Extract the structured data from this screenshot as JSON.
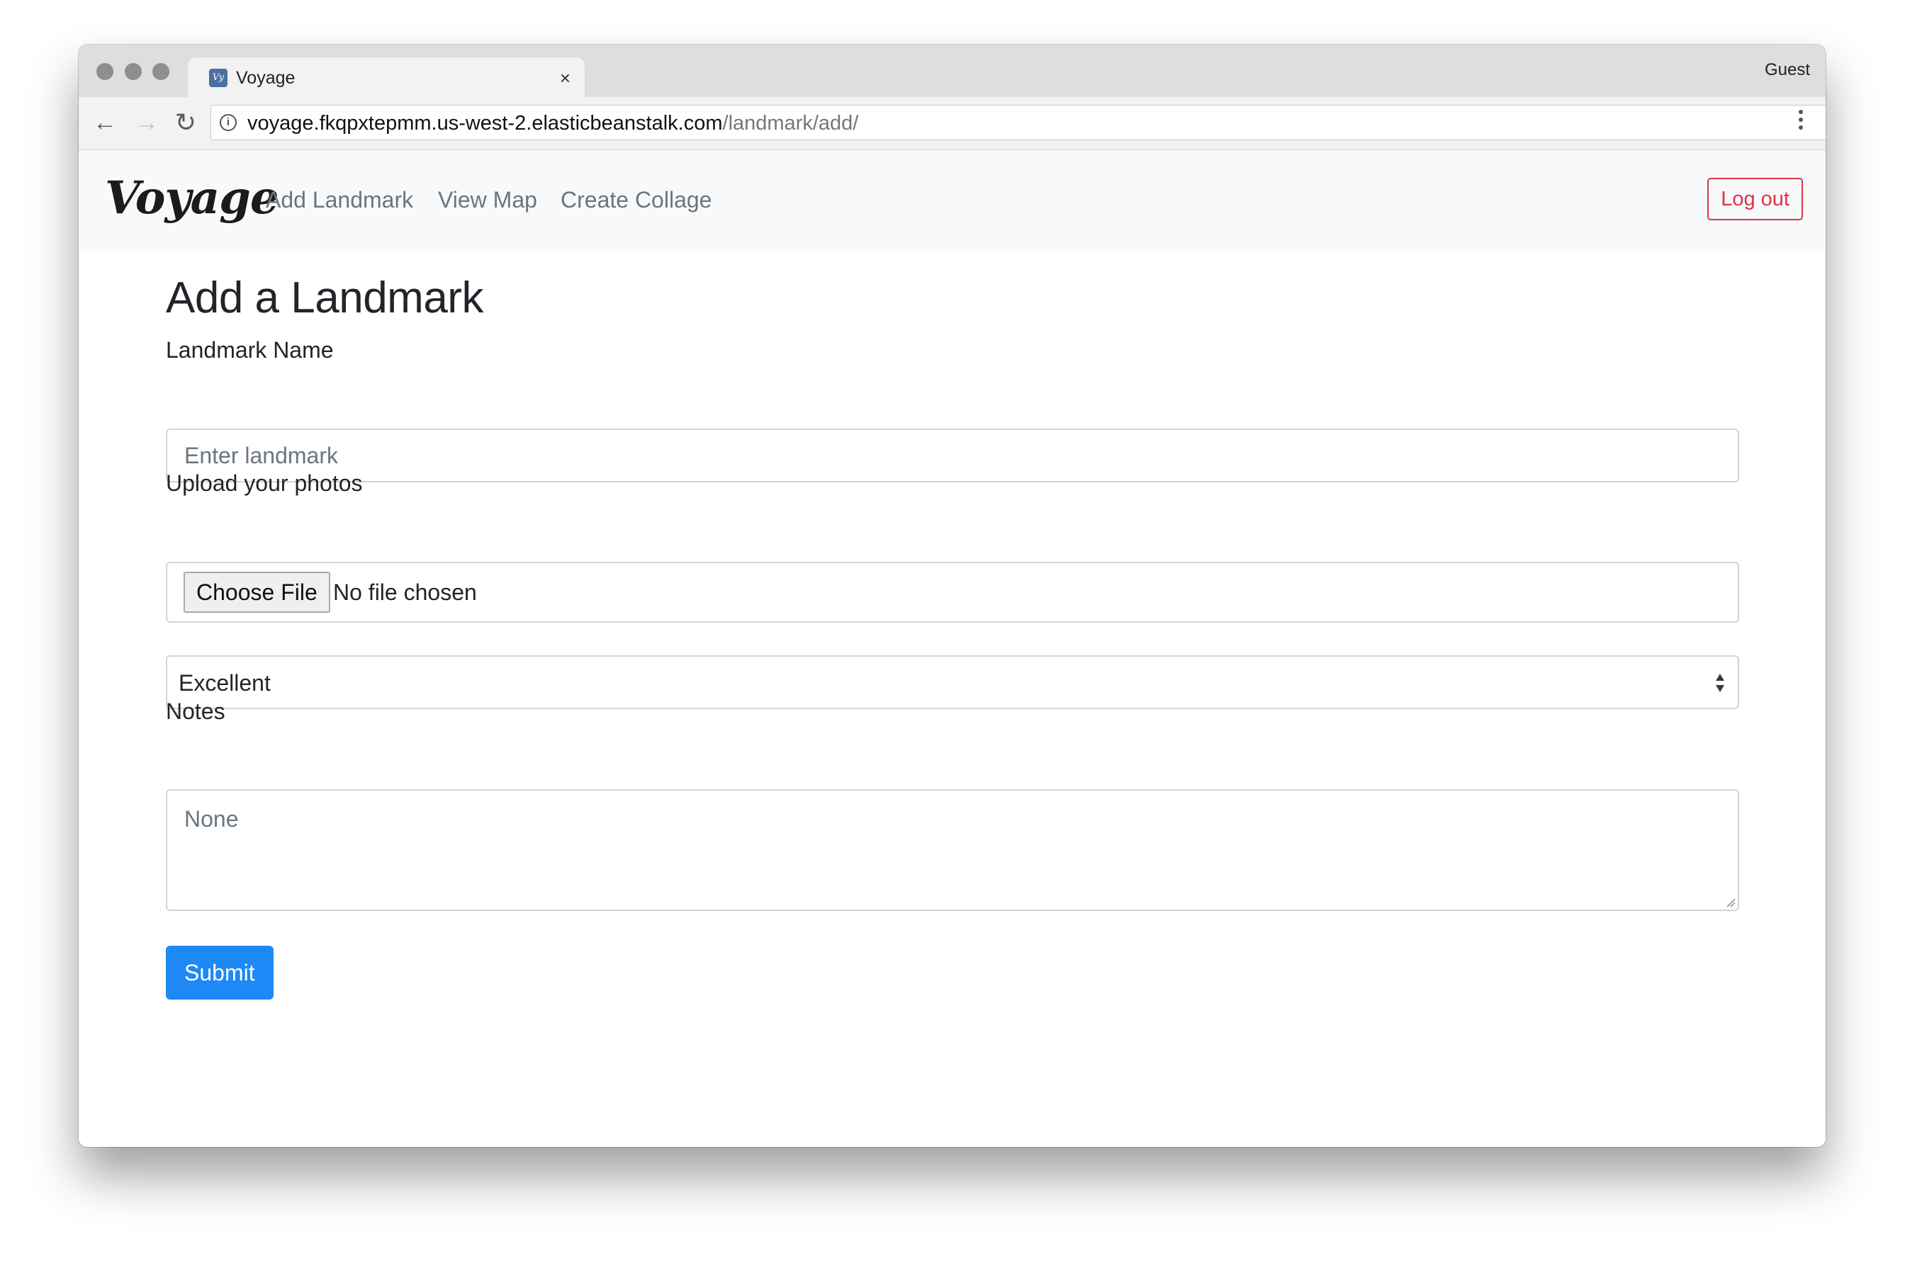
{
  "browser": {
    "tab": {
      "favicon_text": "Vy",
      "title": "Voyage",
      "close": "×"
    },
    "profile": "Guest",
    "address_bar": {
      "host": "voyage.fkqpxtepmm.us-west-2.elasticbeanstalk.com",
      "path": "/landmark/add/"
    },
    "controls": {
      "back": "←",
      "forward": "→",
      "reload": "↻",
      "info": "i"
    }
  },
  "navbar": {
    "brand": "Voyage",
    "links": [
      {
        "label": "Add Landmark"
      },
      {
        "label": "View Map"
      },
      {
        "label": "Create Collage"
      }
    ],
    "logout_label": "Log out"
  },
  "form": {
    "title": "Add a Landmark",
    "landmark_name": {
      "label": "Landmark Name",
      "placeholder": "Enter landmark",
      "value": ""
    },
    "photos": {
      "label": "Upload your photos",
      "button_label": "Choose File",
      "status": "No file chosen"
    },
    "rating": {
      "selected": "Excellent"
    },
    "notes": {
      "label": "Notes",
      "placeholder": "None",
      "value": ""
    },
    "submit_label": "Submit"
  },
  "colors": {
    "primary": "#1e88f6",
    "danger": "#dc3545",
    "navbar_bg": "#f8f9fa",
    "muted_text": "#6c757d"
  },
  "icons": {
    "info": "info-icon",
    "menu": "vertical-dots-icon",
    "select": "sort-arrows-icon"
  }
}
